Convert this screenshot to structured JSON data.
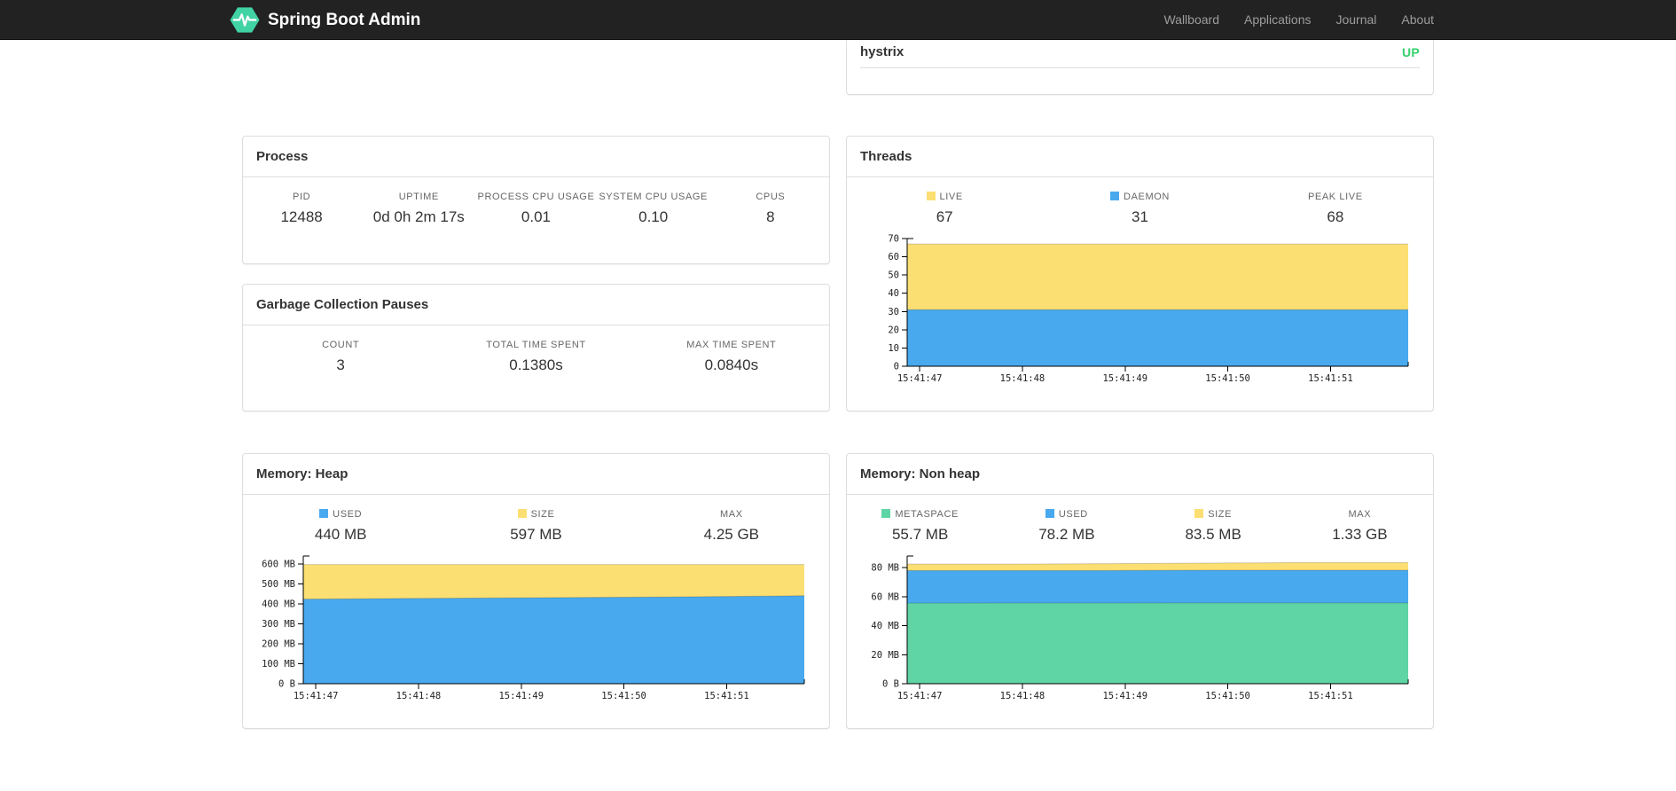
{
  "navbar": {
    "brand": "Spring Boot Admin",
    "items": [
      {
        "label": "Wallboard"
      },
      {
        "label": "Applications"
      },
      {
        "label": "Journal"
      },
      {
        "label": "About"
      }
    ]
  },
  "colors": {
    "navbar_bg": "#222222",
    "nav_link": "#9d9d9d",
    "brand_green": "#42d3a5",
    "status_up_green": "#32d16b",
    "panel_border": "#dddddd",
    "series_yellow": "#fcdf72",
    "series_blue": "#48a9ee",
    "series_green": "#5fd4a5"
  },
  "service_panel": {
    "name": "hystrix",
    "status": "UP"
  },
  "panels": {
    "process": {
      "title": "Process",
      "metrics": [
        {
          "label": "PID",
          "value": "12488"
        },
        {
          "label": "UPTIME",
          "value": "0d 0h 2m 17s"
        },
        {
          "label": "PROCESS CPU USAGE",
          "value": "0.01"
        },
        {
          "label": "SYSTEM CPU USAGE",
          "value": "0.10"
        },
        {
          "label": "CPUS",
          "value": "8"
        }
      ]
    },
    "gc": {
      "title": "Garbage Collection Pauses",
      "metrics": [
        {
          "label": "COUNT",
          "value": "3"
        },
        {
          "label": "TOTAL TIME SPENT",
          "value": "0.1380s"
        },
        {
          "label": "MAX TIME SPENT",
          "value": "0.0840s"
        }
      ]
    },
    "threads": {
      "title": "Threads",
      "metrics": [
        {
          "label": "LIVE",
          "value": "67",
          "swatch": "#fcdf72"
        },
        {
          "label": "DAEMON",
          "value": "31",
          "swatch": "#48a9ee"
        },
        {
          "label": "PEAK LIVE",
          "value": "68"
        }
      ]
    },
    "heap": {
      "title": "Memory: Heap",
      "metrics": [
        {
          "label": "USED",
          "value": "440 MB",
          "swatch": "#48a9ee"
        },
        {
          "label": "SIZE",
          "value": "597 MB",
          "swatch": "#fcdf72"
        },
        {
          "label": "MAX",
          "value": "4.25 GB"
        }
      ]
    },
    "nonheap": {
      "title": "Memory: Non heap",
      "metrics": [
        {
          "label": "METASPACE",
          "value": "55.7 MB",
          "swatch": "#5fd4a5"
        },
        {
          "label": "USED",
          "value": "78.2 MB",
          "swatch": "#48a9ee"
        },
        {
          "label": "SIZE",
          "value": "83.5 MB",
          "swatch": "#fcdf72"
        },
        {
          "label": "MAX",
          "value": "1.33 GB"
        }
      ]
    }
  },
  "chart_data": [
    {
      "id": "threads",
      "type": "area",
      "title": "Threads",
      "xlabel": "",
      "ylabel": "",
      "grid": false,
      "legend_position": "top",
      "ylim": [
        0,
        70
      ],
      "y_ticks": {
        "values": [
          0,
          10,
          20,
          30,
          40,
          50,
          60,
          70
        ],
        "labels": [
          "0",
          "10",
          "20",
          "30",
          "40",
          "50",
          "60",
          "70"
        ]
      },
      "x_ticks": {
        "labels": [
          "15:41:47",
          "15:41:48",
          "15:41:49",
          "15:41:50",
          "15:41:51"
        ],
        "fractions": [
          0.025,
          0.23,
          0.435,
          0.64,
          0.845
        ]
      },
      "points_x": [
        0,
        0.2,
        0.4,
        0.6,
        0.8,
        1
      ],
      "series": [
        {
          "name": "LIVE",
          "color": "#fcdf72",
          "values": [
            67,
            67,
            67,
            67,
            67,
            67
          ]
        },
        {
          "name": "DAEMON",
          "color": "#48a9ee",
          "values": [
            31,
            31,
            31,
            31,
            31,
            31
          ]
        }
      ]
    },
    {
      "id": "heap",
      "type": "area",
      "title": "Memory: Heap",
      "xlabel": "",
      "ylabel": "",
      "grid": false,
      "legend_position": "top",
      "ylim": [
        0,
        640
      ],
      "y_ticks": {
        "values": [
          0,
          100,
          200,
          300,
          400,
          500,
          600
        ],
        "labels": [
          "0 B",
          "100 MB",
          "200 MB",
          "300 MB",
          "400 MB",
          "500 MB",
          "600 MB"
        ]
      },
      "x_ticks": {
        "labels": [
          "15:41:47",
          "15:41:48",
          "15:41:49",
          "15:41:50",
          "15:41:51"
        ],
        "fractions": [
          0.025,
          0.23,
          0.435,
          0.64,
          0.845
        ]
      },
      "points_x": [
        0,
        0.2,
        0.4,
        0.6,
        0.8,
        1
      ],
      "series": [
        {
          "name": "SIZE",
          "color": "#fcdf72",
          "values": [
            597,
            597,
            597,
            597,
            597,
            597
          ]
        },
        {
          "name": "USED",
          "color": "#48a9ee",
          "values": [
            424,
            427,
            430,
            433,
            436,
            441
          ]
        }
      ]
    },
    {
      "id": "nonheap",
      "type": "area",
      "title": "Memory: Non heap",
      "xlabel": "",
      "ylabel": "",
      "grid": false,
      "legend_position": "top",
      "ylim": [
        0,
        88
      ],
      "y_ticks": {
        "values": [
          0,
          20,
          40,
          60,
          80
        ],
        "labels": [
          "0 B",
          "20 MB",
          "40 MB",
          "60 MB",
          "80 MB"
        ]
      },
      "x_ticks": {
        "labels": [
          "15:41:47",
          "15:41:48",
          "15:41:49",
          "15:41:50",
          "15:41:51"
        ],
        "fractions": [
          0.025,
          0.23,
          0.435,
          0.64,
          0.845
        ]
      },
      "points_x": [
        0,
        0.2,
        0.4,
        0.6,
        0.8,
        1
      ],
      "series": [
        {
          "name": "SIZE",
          "color": "#fcdf72",
          "values": [
            82.4,
            82.4,
            82.7,
            83.1,
            83.5,
            83.5
          ]
        },
        {
          "name": "USED",
          "color": "#48a9ee",
          "values": [
            78,
            78,
            78,
            78.2,
            78.2,
            78.2
          ]
        },
        {
          "name": "METASPACE",
          "color": "#5fd4a5",
          "values": [
            55.5,
            55.6,
            55.6,
            55.7,
            55.7,
            55.7
          ]
        }
      ]
    }
  ]
}
